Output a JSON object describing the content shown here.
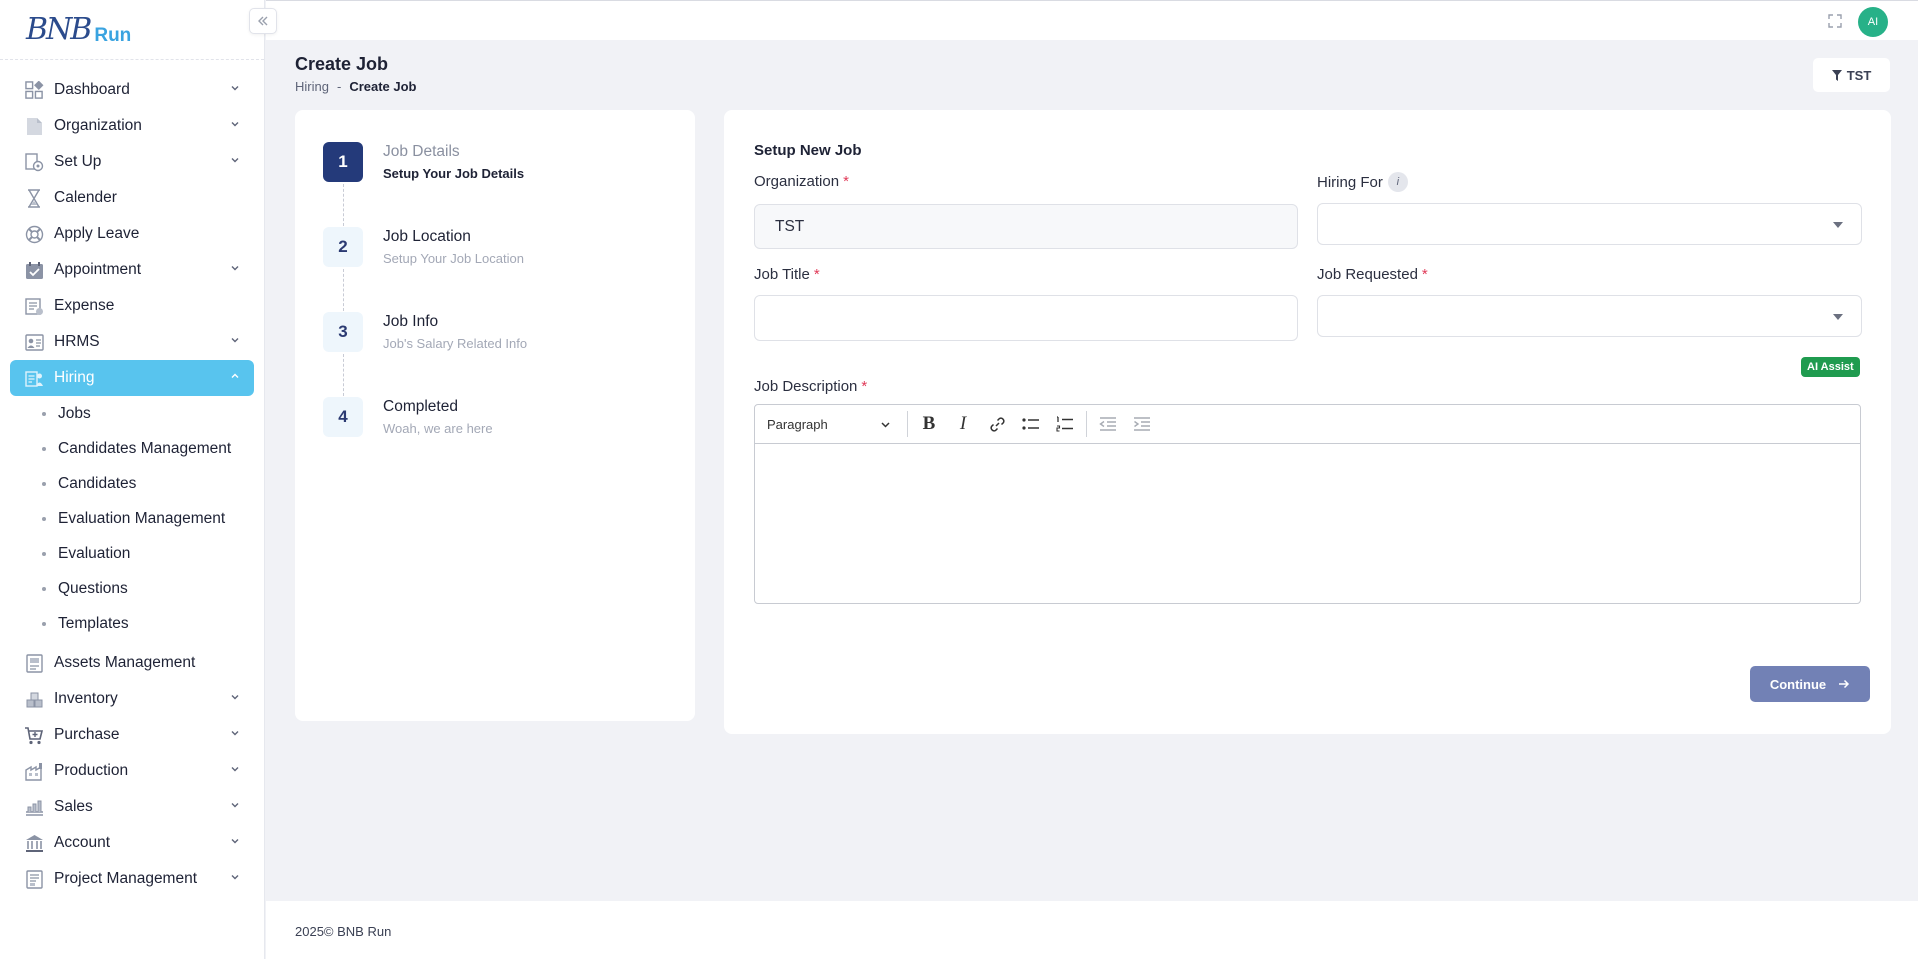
{
  "brand": {
    "logo_text": "BNB",
    "logo_run": "Run"
  },
  "topbar": {
    "avatar_initials": "AI"
  },
  "sidebar": {
    "items": [
      {
        "label": "Dashboard",
        "icon": "dashboard-icon",
        "has_children": true
      },
      {
        "label": "Organization",
        "icon": "document-icon",
        "has_children": true
      },
      {
        "label": "Set Up",
        "icon": "settings-doc-icon",
        "has_children": true
      },
      {
        "label": "Calender",
        "icon": "hourglass-icon",
        "has_children": false
      },
      {
        "label": "Apply Leave",
        "icon": "lifebuoy-icon",
        "has_children": false
      },
      {
        "label": "Appointment",
        "icon": "calendar-check-icon",
        "has_children": true
      },
      {
        "label": "Expense",
        "icon": "expense-icon",
        "has_children": false
      },
      {
        "label": "HRMS",
        "icon": "hrms-icon",
        "has_children": true
      },
      {
        "label": "Hiring",
        "icon": "hiring-icon",
        "has_children": true,
        "active": true
      },
      {
        "label": "Assets Management",
        "icon": "assets-icon",
        "has_children": false
      },
      {
        "label": "Inventory",
        "icon": "inventory-icon",
        "has_children": true
      },
      {
        "label": "Purchase",
        "icon": "cart-icon",
        "has_children": true
      },
      {
        "label": "Production",
        "icon": "factory-icon",
        "has_children": true
      },
      {
        "label": "Sales",
        "icon": "sales-icon",
        "has_children": true
      },
      {
        "label": "Account",
        "icon": "bank-icon",
        "has_children": true
      },
      {
        "label": "Project Management",
        "icon": "project-icon",
        "has_children": true
      }
    ],
    "hiring_sub": [
      "Jobs",
      "Candidates Management",
      "Candidates",
      "Evaluation Management",
      "Evaluation",
      "Questions",
      "Templates"
    ]
  },
  "page": {
    "title": "Create Job",
    "breadcrumb": {
      "parent": "Hiring",
      "separator": "-",
      "current": "Create Job"
    },
    "filter_label": "TST"
  },
  "stepper": {
    "steps": [
      {
        "num": "1",
        "title": "Job Details",
        "sub": "Setup Your Job Details",
        "active": true
      },
      {
        "num": "2",
        "title": "Job Location",
        "sub": "Setup Your Job Location"
      },
      {
        "num": "3",
        "title": "Job Info",
        "sub": "Job's Salary Related Info"
      },
      {
        "num": "4",
        "title": "Completed",
        "sub": "Woah, we are here"
      }
    ]
  },
  "form": {
    "heading": "Setup New Job",
    "organization": {
      "label": "Organization",
      "value": "TST"
    },
    "hiring_for": {
      "label": "Hiring For",
      "value": ""
    },
    "job_title": {
      "label": "Job Title",
      "value": ""
    },
    "job_requested": {
      "label": "Job Requested",
      "value": ""
    },
    "ai_assist": "AI Assist",
    "job_description": {
      "label": "Job Description",
      "format": "Paragraph"
    },
    "required_mark": "*",
    "info_mark": "i",
    "continue_label": "Continue"
  },
  "footer": {
    "text": "2025© BNB Run"
  },
  "colors": {
    "accent": "#58c4ee",
    "primary": "#243a7a",
    "success": "#1f9b4f",
    "button": "#7281b5",
    "required": "#e03a58"
  }
}
